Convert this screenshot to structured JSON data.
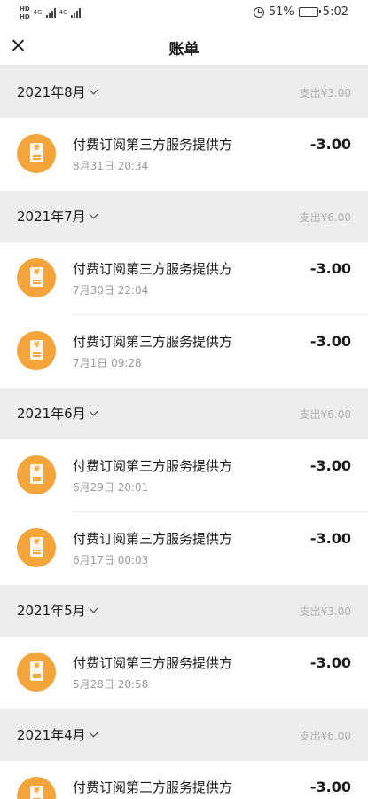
{
  "status_bar": {
    "net_label_1": "HD",
    "net_label_2": "HD",
    "signal_1": "4G",
    "signal_2": "4G",
    "battery_text": "51%",
    "battery_level": 0.51,
    "time": "5:02"
  },
  "nav": {
    "title": "账单"
  },
  "months": [
    {
      "label": "2021年8月",
      "total": "支出¥3.00",
      "items": [
        {
          "title": "付费订阅第三方服务提供方",
          "date": "8月31日 20:34",
          "amount": "-3.00"
        }
      ]
    },
    {
      "label": "2021年7月",
      "total": "支出¥6.00",
      "items": [
        {
          "title": "付费订阅第三方服务提供方",
          "date": "7月30日 22:04",
          "amount": "-3.00"
        },
        {
          "title": "付费订阅第三方服务提供方",
          "date": "7月1日 09:28",
          "amount": "-3.00"
        }
      ]
    },
    {
      "label": "2021年6月",
      "total": "支出¥6.00",
      "items": [
        {
          "title": "付费订阅第三方服务提供方",
          "date": "6月29日 20:01",
          "amount": "-3.00"
        },
        {
          "title": "付费订阅第三方服务提供方",
          "date": "6月17日 00:03",
          "amount": "-3.00"
        }
      ]
    },
    {
      "label": "2021年5月",
      "total": "支出¥3.00",
      "items": [
        {
          "title": "付费订阅第三方服务提供方",
          "date": "5月28日 20:58",
          "amount": "-3.00"
        }
      ]
    },
    {
      "label": "2021年4月",
      "total": "支出¥6.00",
      "items": [
        {
          "title": "付费订阅第三方服务提供方",
          "date": "",
          "amount": "-3.00"
        }
      ]
    }
  ],
  "colors": {
    "icon_bg": "#f3a43b",
    "month_bg": "#ededed",
    "muted_text": "#9a9a9a"
  },
  "icons": {
    "close": "close-icon",
    "bill": "bill-icon",
    "expand": "chevron-down-icon"
  }
}
